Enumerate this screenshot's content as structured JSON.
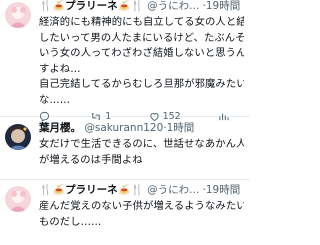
{
  "tweets": [
    {
      "name": "🍴🍝プラリーネ🍝🍴",
      "handle": "@うにわ",
      "sep": "...",
      "time": "·19時間",
      "lines": [
        "経済的にも精神的にも自立してる女の人と結婚",
        "したいって男の人たまにいるけど、たぶんそう",
        "いう女の人ってわざわざ結婚しないと思うんで",
        "すよね…",
        "自己完結してるからむしろ旦那が邪魔みたい",
        "な……"
      ],
      "actions": {
        "reply_count": "",
        "retweet_count": "1",
        "like_count": "152",
        "views_count": ""
      }
    },
    {
      "name": "葉月櫻。",
      "handle": "@sakurann120",
      "sep": "·",
      "time": "1時間",
      "lines": [
        "女だけで生活できるのに、世話せなあかん人",
        "が増えるのは手間よね"
      ]
    },
    {
      "name": "🍴🍝プラリーネ🍝🍴",
      "handle": "@うにわ...",
      "sep": "",
      "time": "·19時間",
      "lines": [
        "産んだ覚えのない子供が増えるようなみたいな",
        "ものだし……"
      ]
    }
  ],
  "icons": {
    "reply": "reply-icon",
    "retweet": "retweet-icon",
    "like": "heart-icon",
    "views": "views-icon"
  }
}
